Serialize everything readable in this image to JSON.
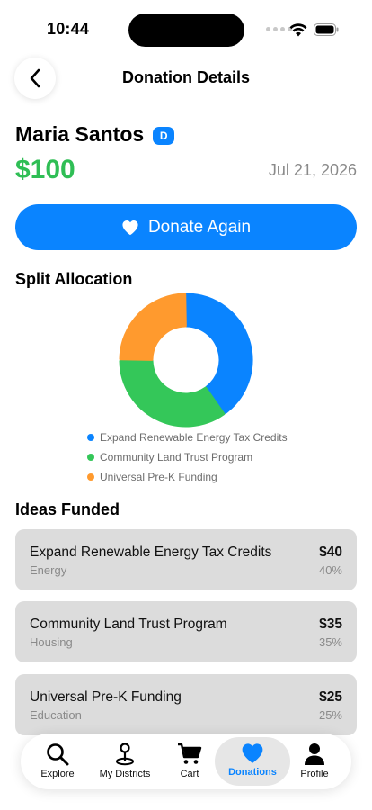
{
  "status": {
    "time": "10:44"
  },
  "header": {
    "title": "Donation Details"
  },
  "donor": {
    "name": "Maria Santos",
    "party": "D",
    "amount": "$100",
    "date": "Jul 21, 2026"
  },
  "actions": {
    "donate_again": "Donate Again"
  },
  "sections": {
    "split_allocation": "Split Allocation",
    "ideas_funded": "Ideas Funded"
  },
  "colors": {
    "accent": "#0a84ff",
    "green": "#34c759",
    "orange": "#ff9a2e",
    "amount_green": "#2fbe55"
  },
  "chart_data": {
    "type": "pie",
    "categories": [
      "Expand Renewable Energy Tax Credits",
      "Community Land Trust Program",
      "Universal Pre-K Funding"
    ],
    "values": [
      40,
      35,
      25
    ],
    "colors": [
      "#0a84ff",
      "#34c759",
      "#ff9a2e"
    ],
    "legend_position": "bottom"
  },
  "ideas": [
    {
      "title": "Expand Renewable Energy Tax Credits",
      "category": "Energy",
      "amount": "$40",
      "percent": "40%"
    },
    {
      "title": "Community Land Trust Program",
      "category": "Housing",
      "amount": "$35",
      "percent": "35%"
    },
    {
      "title": "Universal Pre-K Funding",
      "category": "Education",
      "amount": "$25",
      "percent": "25%"
    }
  ],
  "tabs": [
    {
      "label": "Explore",
      "icon": "search-icon"
    },
    {
      "label": "My Districts",
      "icon": "map-pin-icon"
    },
    {
      "label": "Cart",
      "icon": "cart-icon"
    },
    {
      "label": "Donations",
      "icon": "heart-icon",
      "active": true
    },
    {
      "label": "Profile",
      "icon": "person-icon"
    }
  ]
}
